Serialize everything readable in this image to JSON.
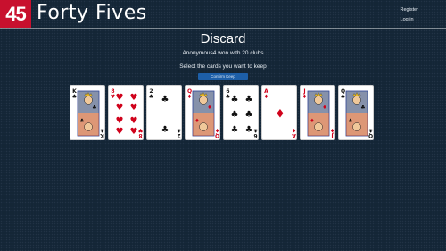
{
  "header": {
    "logo_number": "45",
    "brand_name": "Forty Fives",
    "nav": {
      "register": "Register",
      "login": "Log in"
    }
  },
  "main": {
    "title": "Discard",
    "status": "Anonymous4 won with 20 clubs",
    "prompt": "Select the cards you want to keep",
    "confirm_button": "Confirm Keep"
  },
  "hand": [
    {
      "rank": "K",
      "suit": "clubs"
    },
    {
      "rank": "8",
      "suit": "hearts"
    },
    {
      "rank": "2",
      "suit": "clubs"
    },
    {
      "rank": "Q",
      "suit": "diamonds"
    },
    {
      "rank": "6",
      "suit": "clubs"
    },
    {
      "rank": "A",
      "suit": "diamonds"
    },
    {
      "rank": "J",
      "suit": "diamonds"
    },
    {
      "rank": "Q",
      "suit": "clubs"
    }
  ],
  "colors": {
    "background": "#16283a",
    "logo_badge": "#c8102e",
    "confirm_button": "#1d5fa8",
    "red_suit": "#d0021b",
    "black_suit": "#111111"
  }
}
